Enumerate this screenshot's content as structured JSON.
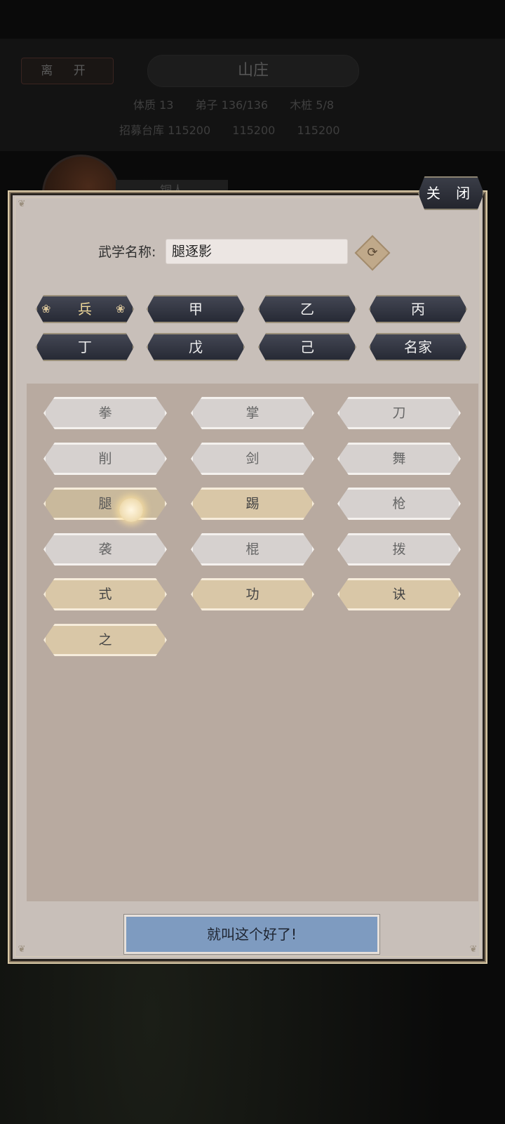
{
  "background": {
    "leave_label": "离 开",
    "title": "山庄",
    "stats_row1": [
      "体质 13",
      "弟子 136/136",
      "木桩 5/8"
    ],
    "stats_row2": [
      "招募台库 115200",
      "115200",
      "115200"
    ],
    "tag_label": "铜人"
  },
  "dialog": {
    "close_label": "关 闭",
    "name_label": "武学名称:",
    "name_value": "腿逐影",
    "refresh_icon": "⟳",
    "grades": [
      {
        "label": "兵",
        "active": true
      },
      {
        "label": "甲",
        "active": false
      },
      {
        "label": "乙",
        "active": false
      },
      {
        "label": "丙",
        "active": false
      },
      {
        "label": "丁",
        "active": false
      },
      {
        "label": "戊",
        "active": false
      },
      {
        "label": "己",
        "active": false
      },
      {
        "label": "名家",
        "active": false
      }
    ],
    "words": [
      {
        "label": "拳",
        "style": "plain"
      },
      {
        "label": "掌",
        "style": "plain"
      },
      {
        "label": "刀",
        "style": "plain"
      },
      {
        "label": "削",
        "style": "plain"
      },
      {
        "label": "剑",
        "style": "plain"
      },
      {
        "label": "舞",
        "style": "plain"
      },
      {
        "label": "腿",
        "style": "selected"
      },
      {
        "label": "踢",
        "style": "gold"
      },
      {
        "label": "枪",
        "style": "plain"
      },
      {
        "label": "袭",
        "style": "plain"
      },
      {
        "label": "棍",
        "style": "plain"
      },
      {
        "label": "拨",
        "style": "plain"
      },
      {
        "label": "式",
        "style": "gold"
      },
      {
        "label": "功",
        "style": "gold"
      },
      {
        "label": "诀",
        "style": "gold"
      },
      {
        "label": "之",
        "style": "gold"
      }
    ],
    "confirm_label": "就叫这个好了!"
  }
}
